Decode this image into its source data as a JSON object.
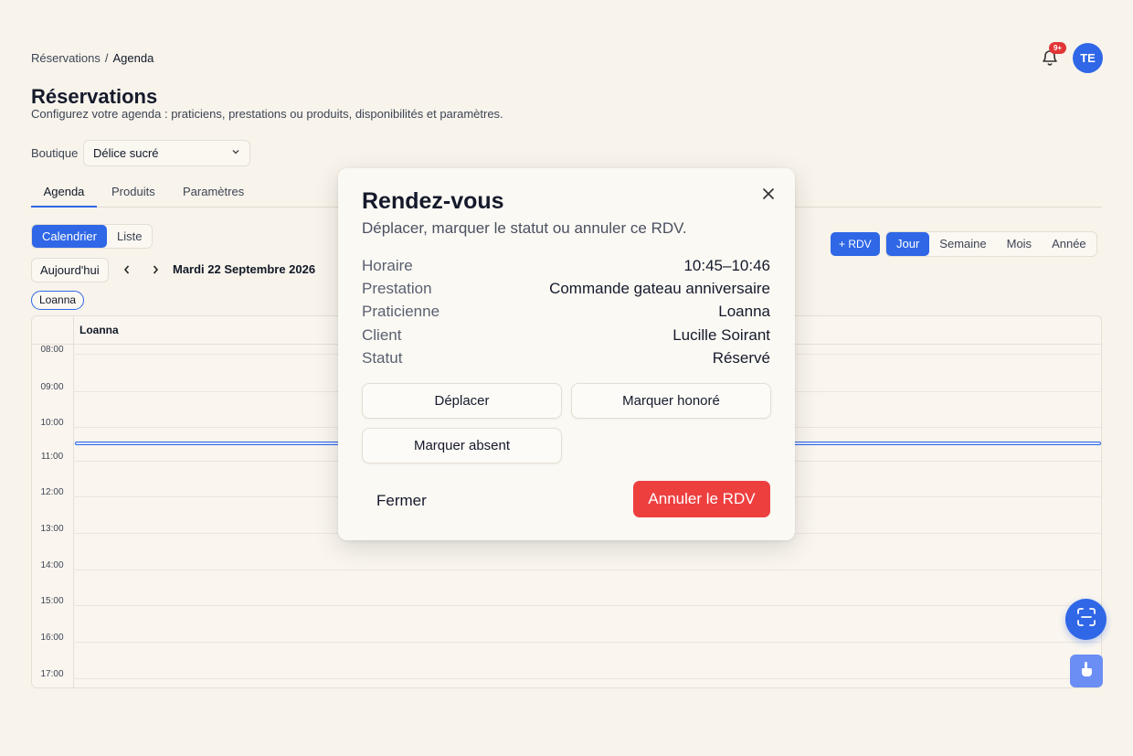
{
  "breadcrumb": {
    "parent": "Réservations",
    "separator": "/",
    "current": "Agenda"
  },
  "header": {
    "notification_badge": "9+",
    "avatar_initials": "TE",
    "accent": "#2f67e6"
  },
  "page": {
    "title": "Réservations",
    "subtitle": "Configurez votre agenda : praticiens, prestations ou produits, disponibilités et paramètres."
  },
  "shop": {
    "label": "Boutique",
    "selected": "Délice sucré"
  },
  "tabs": [
    {
      "label": "Agenda",
      "active": true
    },
    {
      "label": "Produits",
      "active": false
    },
    {
      "label": "Paramètres",
      "active": false
    }
  ],
  "view_switch": [
    {
      "label": "Calendrier",
      "active": true
    },
    {
      "label": "Liste",
      "active": false
    }
  ],
  "toolbar": {
    "today_label": "Aujourd'hui",
    "prev_icon": "chevron-left-icon",
    "next_icon": "chevron-right-icon",
    "date_title": "Mardi 22 Septembre 2026",
    "add_label": "+ RDV"
  },
  "periods": [
    {
      "label": "Jour",
      "active": true
    },
    {
      "label": "Semaine",
      "active": false
    },
    {
      "label": "Mois",
      "active": false
    },
    {
      "label": "Année",
      "active": false
    }
  ],
  "filter_chip": "Loanna",
  "calendar": {
    "column_header": "Loanna",
    "hours": [
      "08:00",
      "09:00",
      "10:00",
      "11:00",
      "12:00",
      "13:00",
      "14:00",
      "15:00",
      "16:00",
      "17:00"
    ]
  },
  "modal": {
    "title": "Rendez-vous",
    "subtitle": "Déplacer, marquer le statut ou annuler ce RDV.",
    "rows": [
      {
        "label": "Horaire",
        "value": "10:45–10:46"
      },
      {
        "label": "Prestation",
        "value": "Commande gateau anniversaire"
      },
      {
        "label": "Praticienne",
        "value": "Loanna"
      },
      {
        "label": "Client",
        "value": "Lucille Soirant"
      },
      {
        "label": "Statut",
        "value": "Réservé"
      }
    ],
    "actions": {
      "move": "Déplacer",
      "mark_honored": "Marquer honoré",
      "mark_absent": "Marquer absent",
      "close": "Fermer",
      "cancel": "Annuler le RDV"
    },
    "cancel_color": "#ee3f3f"
  }
}
